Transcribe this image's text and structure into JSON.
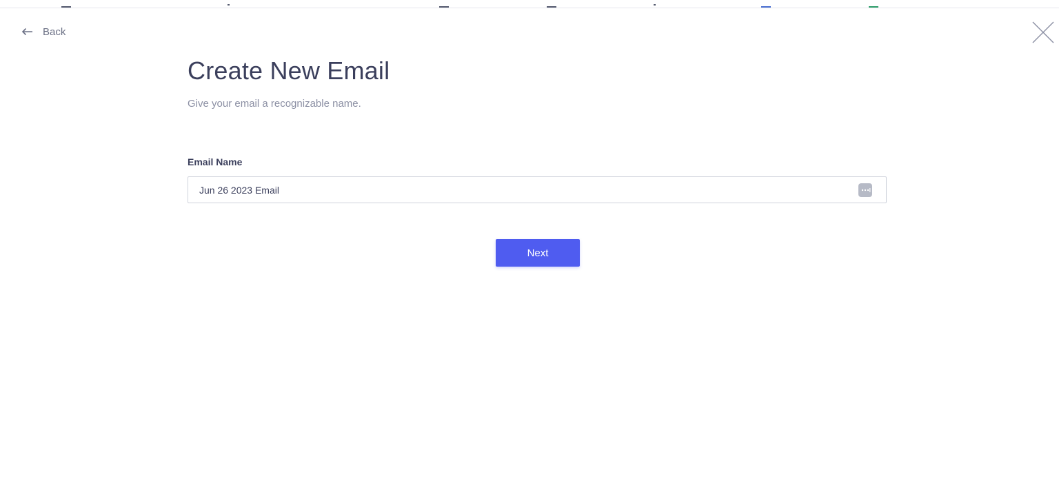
{
  "nav": {
    "back_label": "Back"
  },
  "header": {
    "title": "Create New Email",
    "subtitle": "Give your email a recognizable name."
  },
  "form": {
    "email_name_label": "Email Name",
    "email_name_value": "Jun 26 2023 Email"
  },
  "actions": {
    "next_label": "Next"
  },
  "icons": {
    "back": "arrow-left-icon",
    "close": "close-icon",
    "field": "more-options-icon"
  },
  "colors": {
    "primary": "#4f5cf0",
    "text": "#3b3f5c",
    "muted": "#8b8fa3",
    "border": "#cfd2db"
  }
}
